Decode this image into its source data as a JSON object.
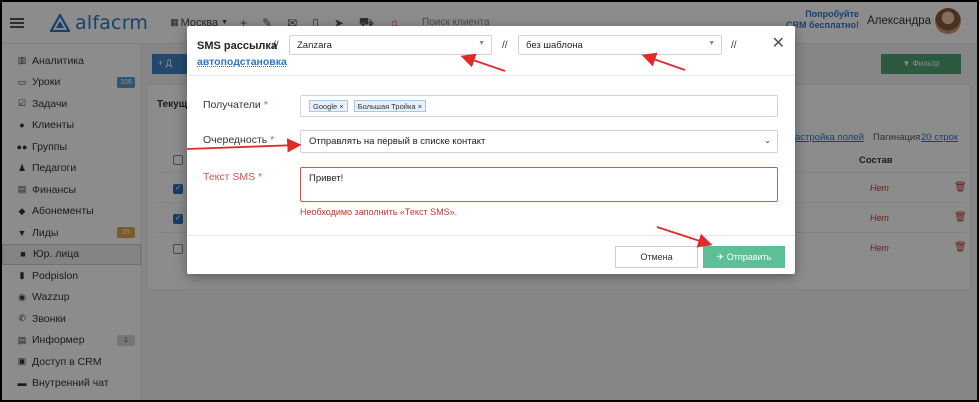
{
  "topbar": {
    "logo_text": "alfacrm",
    "branch": "Москва",
    "search_placeholder": "Поиск клиента",
    "promo_line1": "Попробуйте",
    "promo_line2": "CRM бесплатно!",
    "user_name": "Александра"
  },
  "sidebar": {
    "items": [
      {
        "label": "Аналитика",
        "icon": "chart-icon"
      },
      {
        "label": "Уроки",
        "icon": "calendar-icon",
        "badge": "106"
      },
      {
        "label": "Задачи",
        "icon": "tasks-icon"
      },
      {
        "label": "Клиенты",
        "icon": "user-icon"
      },
      {
        "label": "Группы",
        "icon": "users-icon"
      },
      {
        "label": "Педагоги",
        "icon": "teacher-icon"
      },
      {
        "label": "Финансы",
        "icon": "money-icon"
      },
      {
        "label": "Абонементы",
        "icon": "tag-icon"
      },
      {
        "label": "Лиды",
        "icon": "funnel-icon",
        "badge": "25"
      },
      {
        "label": "Юр. лица",
        "icon": "briefcase-icon",
        "active": true
      },
      {
        "label": "Podpislon",
        "icon": "document-icon"
      },
      {
        "label": "Wazzup",
        "icon": "whatsapp-icon"
      },
      {
        "label": "Звонки",
        "icon": "phone-icon"
      },
      {
        "label": "Информер",
        "icon": "informer-icon",
        "badge": "1"
      },
      {
        "label": "Доступ в CRM",
        "icon": "lock-icon"
      },
      {
        "label": "Внутренний чат",
        "icon": "chat-icon"
      }
    ],
    "colors": {
      "badge_blue": "#5b9bd5",
      "badge_orange": "#e0a64a",
      "badge_gray": "#d8d8d8"
    }
  },
  "main": {
    "add_label": "+ Д",
    "filter_label": "▼ Фильтр",
    "panel_title": "Текущ",
    "settings_link": "астройка полей",
    "pagination_label": "Пагинация",
    "pagination_value": "20 строк",
    "column_header": "Состав",
    "rows": [
      {
        "checked": true,
        "value": "Нет"
      },
      {
        "checked": true,
        "value": "Нет"
      },
      {
        "checked": false,
        "value": "Нет"
      }
    ]
  },
  "modal": {
    "title": "SMS рассылка",
    "separator": "//",
    "provider": "Zanzara",
    "template": "без шаблона",
    "autosubst_link": "автоподстановка",
    "recipients_label": "Получатели",
    "recipients": [
      "Google ×",
      "Большая Тройка ×"
    ],
    "order_label": "Очередность",
    "order_value": "Отправлять на первый в списке контакт",
    "text_label": "Текст SMS",
    "text_value": "Привет!",
    "error_text": "Необходимо заполнить «Текст SMS».",
    "cancel_label": "Отмена",
    "send_label": "✈ Отправить",
    "required_mark": "*"
  },
  "colors": {
    "accent": "#2a77c9",
    "send": "#5cbf98",
    "error": "#d9534f",
    "arrow": "#e02b2b"
  }
}
